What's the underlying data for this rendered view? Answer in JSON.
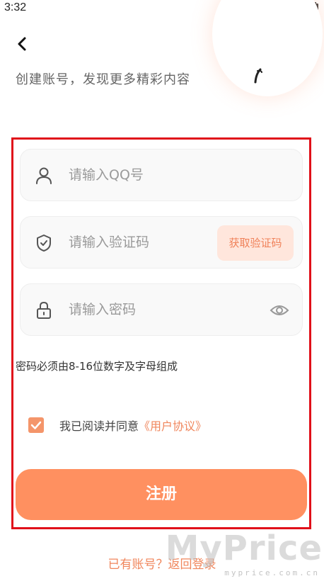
{
  "status_bar": {
    "time": "3:32"
  },
  "header": {
    "subtitle": "创建账号，发现更多精彩内容"
  },
  "form": {
    "qq_field": {
      "placeholder": "请输入QQ号",
      "icon": "user-icon"
    },
    "code_field": {
      "placeholder": "请输入验证码",
      "icon": "shield-icon",
      "button_label": "获取验证码"
    },
    "password_field": {
      "placeholder": "请输入密码",
      "icon": "lock-icon",
      "toggle_icon": "eye-icon"
    },
    "hint": "密码必须由8-16位数字及字母组成",
    "agreement": {
      "checked": true,
      "text": "我已阅读并同意",
      "link": "《用户协议》"
    },
    "register_label": "注册"
  },
  "footer": {
    "login_link": "已有账号？返回登录"
  },
  "watermark": {
    "main": "MyPrice",
    "sub": "myprice.com.cn"
  },
  "colors": {
    "accent": "#ff9060",
    "link": "#f0865c",
    "highlight_box": "#e0101a"
  }
}
